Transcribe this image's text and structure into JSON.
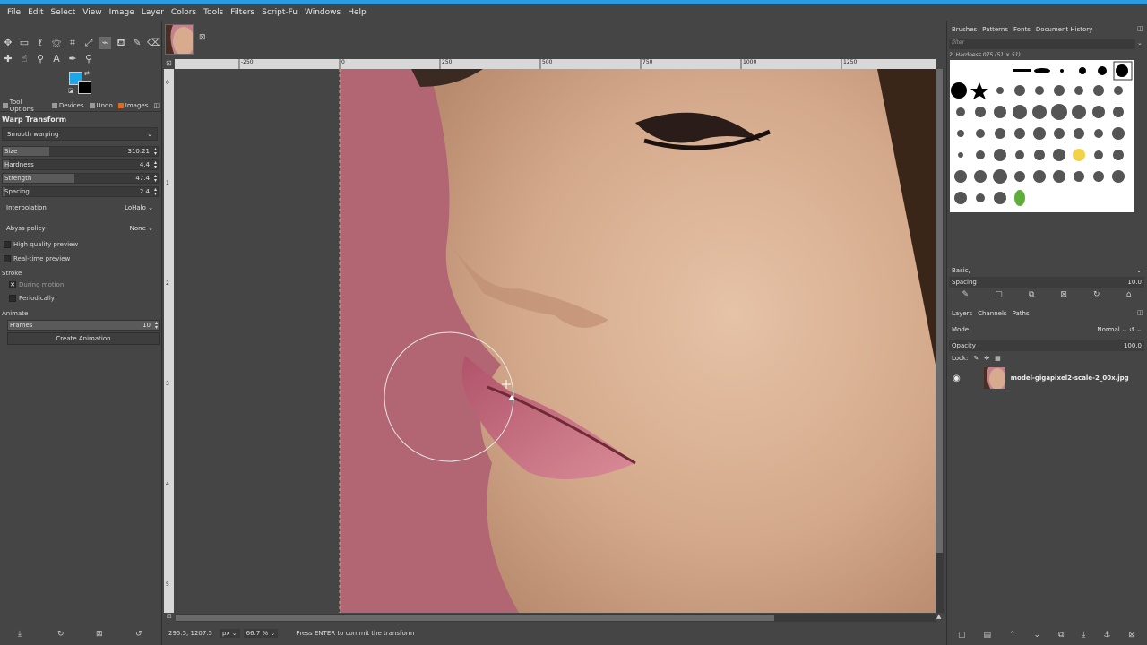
{
  "menu": [
    "File",
    "Edit",
    "Select",
    "View",
    "Image",
    "Layer",
    "Colors",
    "Tools",
    "Filters",
    "Script-Fu",
    "Windows",
    "Help"
  ],
  "left_tabs": [
    "Tool Options",
    "Devices",
    "Undo",
    "Images"
  ],
  "tool_options": {
    "title": "Warp Transform",
    "mode": "Smooth warping",
    "sliders": [
      {
        "label": "Size",
        "value": "310.21",
        "fraction": 0.3
      },
      {
        "label": "Hardness",
        "value": "4.4",
        "fraction": 0.04
      },
      {
        "label": "Strength",
        "value": "47.4",
        "fraction": 0.46
      },
      {
        "label": "Spacing",
        "value": "2.4",
        "fraction": 0.02
      }
    ],
    "interpolation_label": "Interpolation",
    "interpolation_value": "LoHalo",
    "abyss_label": "Abyss policy",
    "abyss_value": "None",
    "hq_preview": "High quality preview",
    "rt_preview": "Real-time preview",
    "stroke_label": "Stroke",
    "during_motion": "During motion",
    "periodically": "Periodically",
    "animate_label": "Animate",
    "frames_label": "Frames",
    "frames_value": "10",
    "create_animation": "Create Animation"
  },
  "ruler_h": [
    "-250",
    "0",
    "250",
    "500",
    "750",
    "1000",
    "1250"
  ],
  "ruler_v": [
    "0",
    "1",
    "2",
    "3",
    "4",
    "5"
  ],
  "status": {
    "coords": "295.5, 1207.5",
    "unit": "px",
    "zoom": "66.7 %",
    "message": "Press ENTER to commit the transform"
  },
  "right_tabs_top": [
    "Brushes",
    "Patterns",
    "Fonts",
    "Document History"
  ],
  "brushes": {
    "filter_placeholder": "filter",
    "current": "2. Hardness 075 (51 × 51)",
    "tag": "Basic,",
    "spacing_label": "Spacing",
    "spacing_value": "10.0"
  },
  "right_tabs_bottom": [
    "Layers",
    "Channels",
    "Paths"
  ],
  "layers": {
    "mode_label": "Mode",
    "mode_value": "Normal",
    "opacity_label": "Opacity",
    "opacity_value": "100.0",
    "lock_label": "Lock:",
    "layer_name": "model-gigapixel2-scale-2_00x.jpg"
  }
}
